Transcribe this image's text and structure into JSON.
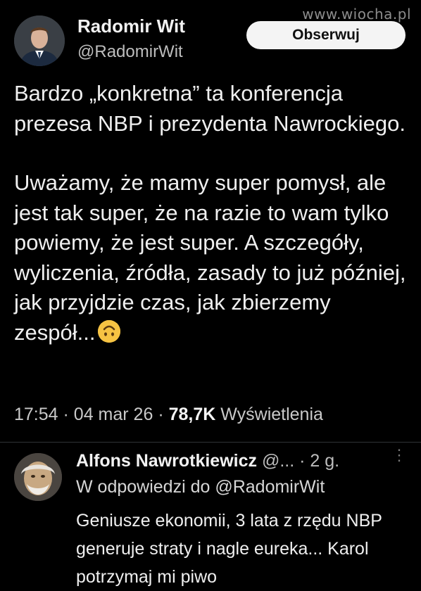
{
  "watermark": "www.wiocha.pl",
  "tweet": {
    "author_name": "Radomir Wit",
    "author_handle": "@RadomirWit",
    "follow_label": "Obserwuj",
    "paragraph1": "Bardzo „konkretna” ta konferencja prezesa NBP i prezydenta Nawrockiego.",
    "paragraph2": "Uważamy, że mamy super pomysł, ale jest tak super, że na razie to wam tylko powiemy, że jest super. A szczegóły, wyliczenia, źródła, zasady to już później, jak przyjdzie czas, jak zbierzemy zespół...",
    "emoji": "upside-down-face-icon",
    "time": "17:54",
    "date": "04 mar 26",
    "views_count": "78,7K",
    "views_label": "Wyświetlenia"
  },
  "reply": {
    "author_name": "Alfons Nawrotkiewicz",
    "author_handle": "@...",
    "time": "2 g.",
    "reply_to": "W odpowiedzi do @RadomirWit",
    "text": "Geniusze ekonomii, 3 lata z rzędu NBP generuje straty i nagle eureka... Karol potrzymaj mi piwo"
  },
  "colors": {
    "background": "#000000",
    "text": "#e7e9ea",
    "muted": "#bdbdbd",
    "follow_bg": "#f4f4f4",
    "emoji": "#f6c343"
  }
}
